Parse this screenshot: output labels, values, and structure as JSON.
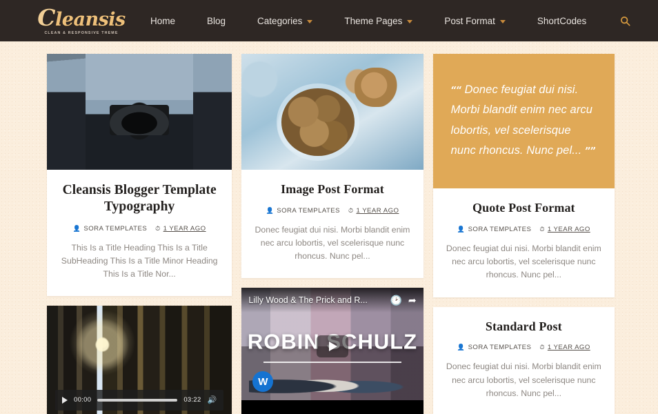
{
  "header": {
    "logo": {
      "cap": "C",
      "rest": "leansis",
      "tagline": "CLEAN & RESPONSIVE THEME"
    },
    "nav": [
      {
        "label": "Home",
        "caret": false
      },
      {
        "label": "Blog",
        "caret": false
      },
      {
        "label": "Categories",
        "caret": true
      },
      {
        "label": "Theme Pages",
        "caret": true
      },
      {
        "label": "Post Format",
        "caret": true
      },
      {
        "label": "ShortCodes",
        "caret": false
      }
    ],
    "search_icon": "search-icon",
    "bg_color": "#2e2724",
    "accent_color": "#d99c3f"
  },
  "meta_labels": {
    "author": "SORA TEMPLATES",
    "date": "1 YEAR AGO",
    "author_icon": "user-icon",
    "date_icon": "clock-icon"
  },
  "posts": {
    "typography": {
      "title": "Cleansis Blogger Template Typography",
      "excerpt": "This Is a Title Heading This Is a Title SubHeading This Is a Title Minor Heading This Is a Title Nor...",
      "image_alt": "woman-holding-camera-photo"
    },
    "image_post": {
      "title": "Image Post Format",
      "excerpt": "Donec feugiat dui nisi. Morbi blandit enim nec arcu lobortis, vel scelerisque nunc rhoncus. Nunc pel...",
      "image_alt": "bowl-of-walnuts-photo"
    },
    "quote_post": {
      "quote": "Donec feugiat dui nisi. Morbi blandit enim nec arcu lobortis, vel scelerisque nunc rhoncus. Nunc pel...",
      "quote_open": "““",
      "quote_close": "””",
      "title": "Quote Post Format",
      "excerpt": "Donec feugiat dui nisi. Morbi blandit enim nec arcu lobortis, vel scelerisque nunc rhoncus. Nunc pel...",
      "bg_color": "#e0a957"
    },
    "standard_post": {
      "title": "Standard Post",
      "excerpt": "Donec feugiat dui nisi. Morbi blandit enim nec arcu lobortis, vel scelerisque nunc rhoncus. Nunc pel..."
    },
    "video_post": {
      "image_alt": "sunlit-forest-photo",
      "current_time": "00:00",
      "duration": "03:22",
      "play_icon": "play-icon",
      "volume_icon": "volume-icon"
    },
    "youtube_post": {
      "title": "Lilly Wood & The Prick and R...",
      "overlay_text": "ROBIN SCHULZ",
      "badge_text": "W",
      "watch_later_icon": "clock-icon",
      "share_icon": "share-icon",
      "play_icon": "play-icon"
    }
  }
}
